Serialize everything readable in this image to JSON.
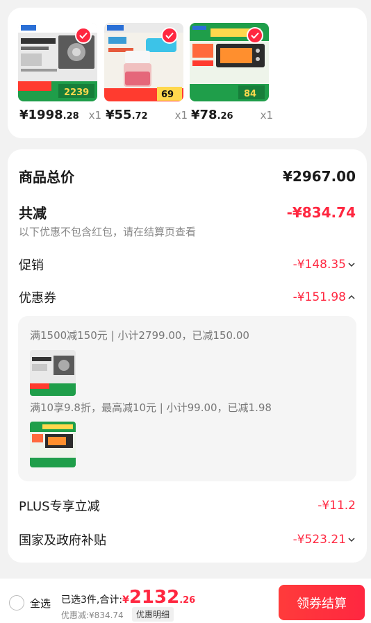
{
  "products": [
    {
      "price_int": "¥1998",
      "price_dec": ".28",
      "qty": "x1",
      "image": "range-hood-image",
      "brand": "Midea",
      "badge": "2239"
    },
    {
      "price_int": "¥55",
      "price_dec": ".72",
      "qty": "x1",
      "image": "food-chopper-image",
      "brand": "Midea",
      "badge": "69"
    },
    {
      "price_int": "¥78",
      "price_dec": ".26",
      "qty": "x1",
      "image": "toaster-oven-image",
      "brand": "Midea",
      "badge": "84"
    }
  ],
  "summary": {
    "total_label": "商品总价",
    "total_value": "¥2967.00",
    "reduce_label": "共减",
    "reduce_value": "-¥834.74",
    "reduce_note": "以下优惠不包含红包，请在结算页查看",
    "promo_label": "促销",
    "promo_value": "-¥148.35",
    "coupon_label": "优惠券",
    "coupon_value": "-¥151.98",
    "coupon_details": [
      {
        "text": "满1500减150元 | 小计2799.00，已减150.00"
      },
      {
        "text": "满10享9.8折，最高减10元 | 小计99.00，已减1.98"
      }
    ],
    "plus_label": "PLUS专享立减",
    "plus_value": "-¥11.2",
    "subsidy_label": "国家及政府补贴",
    "subsidy_value": "-¥523.21"
  },
  "bottom": {
    "select_all": "全选",
    "selected_text": "已选3件,合计:",
    "total_currency": "¥",
    "total_int": "2132",
    "total_dec": ".26",
    "discount": "优惠减:¥834.74",
    "detail_btn": "优惠明细",
    "checkout_btn": "领券结算"
  },
  "colors": {
    "accent": "#ff2740",
    "badge_green": "#1f9e4a"
  }
}
